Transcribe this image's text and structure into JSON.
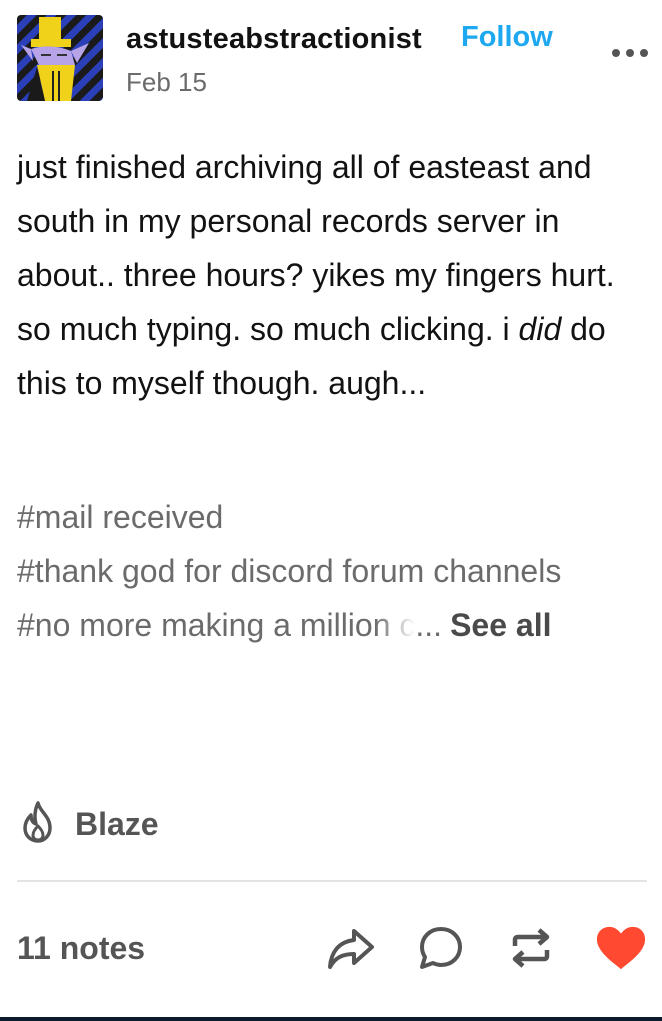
{
  "post": {
    "author": {
      "username": "astusteabstractionist",
      "follow_label": "Follow",
      "date": "Feb 15"
    },
    "body": {
      "text_before": "just finished archiving all of easteast and south in my personal records server in about.. three hours? yikes my fingers hurt. so much typing. so much clicking. i ",
      "text_emphasis": "did",
      "text_after": " do this to myself though. augh..."
    },
    "tags": {
      "items": [
        "#mail received",
        "#thank god for discord forum channels"
      ],
      "truncated_tag": "#no more making a million c",
      "ellipsis": "...",
      "see_all_label": "See all"
    },
    "blaze": {
      "label": "Blaze",
      "icon": "flame-icon"
    },
    "footer": {
      "notes_label": "11 notes",
      "actions": [
        {
          "name": "share",
          "icon": "share-arrow-icon"
        },
        {
          "name": "reply",
          "icon": "comment-bubble-icon"
        },
        {
          "name": "reblog",
          "icon": "reblog-icon"
        },
        {
          "name": "like",
          "icon": "heart-icon"
        }
      ]
    },
    "colors": {
      "follow": "#1ea8f0",
      "like": "#ff4930",
      "text": "#121212",
      "muted": "#6b6b6b"
    }
  }
}
